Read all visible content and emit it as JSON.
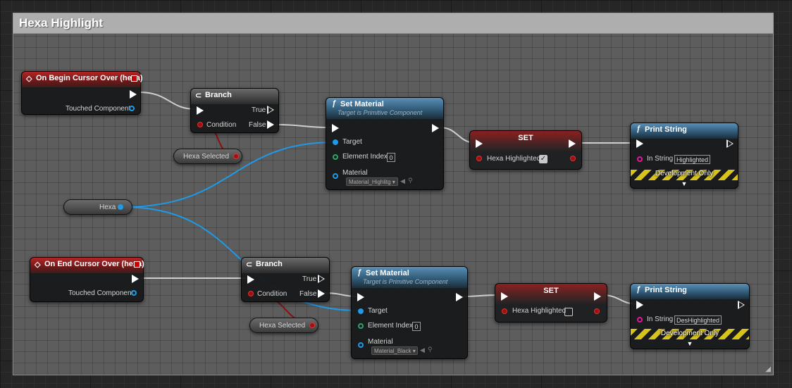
{
  "comment": {
    "title": "Hexa Highlight"
  },
  "top_row": {
    "event": {
      "title": "On Begin Cursor Over (hexa)",
      "output_label": "Touched Component"
    },
    "branch": {
      "title": "Branch",
      "condition_label": "Condition",
      "true_label": "True",
      "false_label": "False"
    },
    "hexa_selected": {
      "label": "Hexa Selected"
    },
    "set_material": {
      "title": "Set Material",
      "subtitle": "Target is Primitive Component",
      "target_label": "Target",
      "element_index_label": "Element Index",
      "element_index_value": "0",
      "material_label": "Material",
      "material_value": "Material_Highlitg"
    },
    "set_node": {
      "title": "SET",
      "var_label": "Hexa Highlighted",
      "checked": true
    },
    "print_string": {
      "title": "Print String",
      "in_string_label": "In String",
      "in_string_value": "Highlighted",
      "dev_label": "Development Only"
    }
  },
  "hexa_var": {
    "label": "Hexa"
  },
  "bottom_row": {
    "event": {
      "title": "On End Cursor Over (hexa)",
      "output_label": "Touched Component"
    },
    "branch": {
      "title": "Branch",
      "condition_label": "Condition",
      "true_label": "True",
      "false_label": "False"
    },
    "hexa_selected": {
      "label": "Hexa Selected"
    },
    "set_material": {
      "title": "Set Material",
      "subtitle": "Target is Primitive Component",
      "target_label": "Target",
      "element_index_label": "Element Index",
      "element_index_value": "0",
      "material_label": "Material",
      "material_value": "Material_Black"
    },
    "set_node": {
      "title": "SET",
      "var_label": "Hexa Highlighted",
      "checked": false
    },
    "print_string": {
      "title": "Print String",
      "in_string_label": "In String",
      "in_string_value": "DesHighlighted",
      "dev_label": "Development Only"
    }
  },
  "colors": {
    "exec_wire": "#cfcfcf",
    "object_wire": "#1e9ae8",
    "bool_wire": "#8c1010",
    "event_header": "#b32626",
    "function_header": "#2d5672",
    "dev_stripe": "#d8c21c"
  }
}
